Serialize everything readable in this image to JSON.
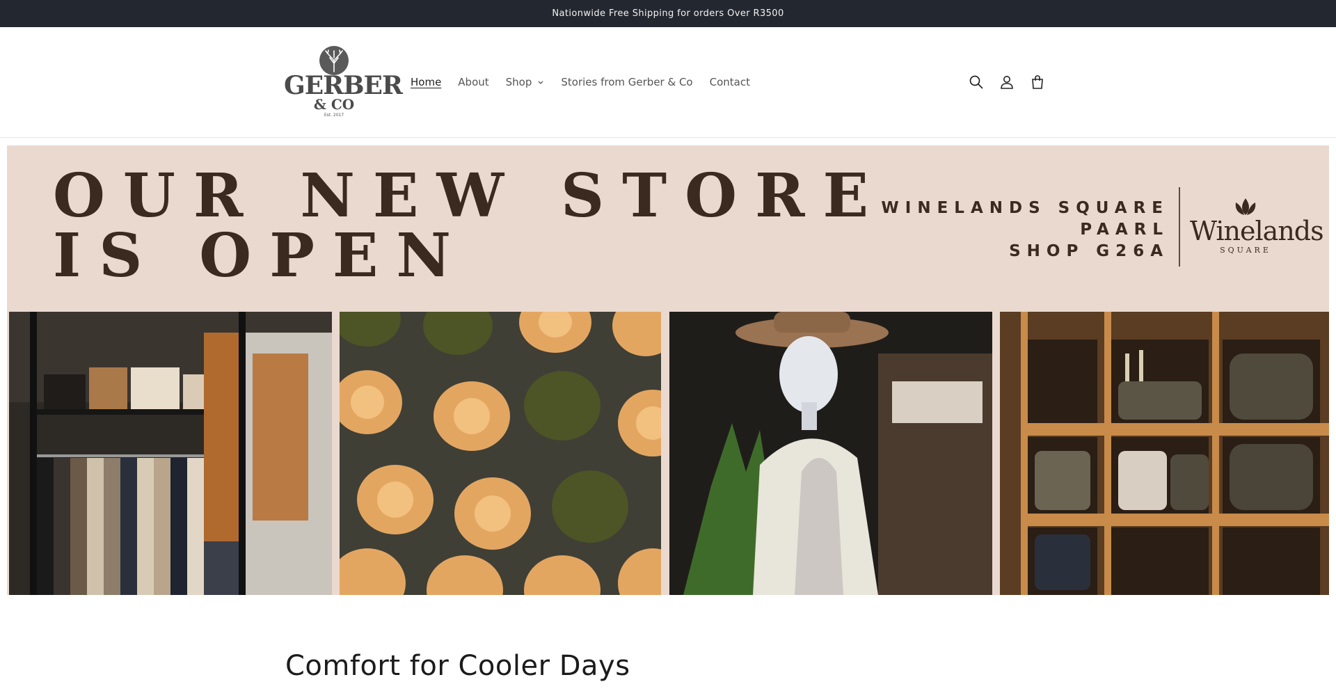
{
  "announcement": {
    "text": "Nationwide Free Shipping for orders Over R3500"
  },
  "header": {
    "logo": {
      "word": "GERBER",
      "sub": "& CO",
      "est": "Est. 2017"
    },
    "nav": [
      {
        "label": "Home",
        "active": true
      },
      {
        "label": "About"
      },
      {
        "label": "Shop",
        "has_dropdown": true
      },
      {
        "label": "Stories from Gerber & Co"
      },
      {
        "label": "Contact"
      }
    ],
    "icons": [
      "search-icon",
      "account-icon",
      "cart-icon"
    ]
  },
  "banner": {
    "headline_line1": "OUR NEW STORE",
    "headline_line2": "IS OPEN",
    "address_line1": "WINELANDS SQUARE",
    "address_line2": "PAARL",
    "address_line3": "SHOP G26A",
    "partner_word": "Winelands",
    "partner_sub": "SQUARE",
    "colors": {
      "background": "#ead9cf",
      "text": "#3a2a1f"
    },
    "photos": [
      "clothing-rack-photo",
      "hat-wall-photo",
      "mannequin-photo",
      "knitwear-shelves-photo"
    ]
  },
  "section": {
    "title": "Comfort for Cooler Days"
  }
}
